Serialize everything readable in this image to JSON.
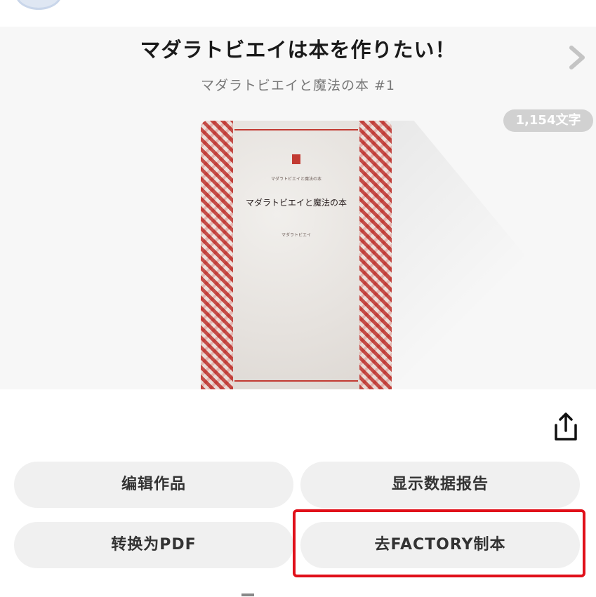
{
  "work": {
    "title": "マダラトビエイは本を作りたい！",
    "subtitle": "マダラトビエイと魔法の本 #1",
    "char_count": "1,154文字",
    "cover": {
      "series": "マダラトビエイと魔法の本",
      "title": "マダラトビエイと魔法の本",
      "author": "マダラトビエイ"
    }
  },
  "actions": {
    "edit_label": "编辑作品",
    "stats_label": "显示数据报告",
    "pdf_label": "转换为PDF",
    "factory_label": "去FACTORY制本"
  },
  "icons": {
    "next": "chevron-right-icon",
    "share": "share-icon"
  },
  "colors": {
    "highlight": "#e0101a",
    "button_bg": "#f0f0f0",
    "badge_bg": "#d1d1d1",
    "cover_red": "#c23a32"
  }
}
